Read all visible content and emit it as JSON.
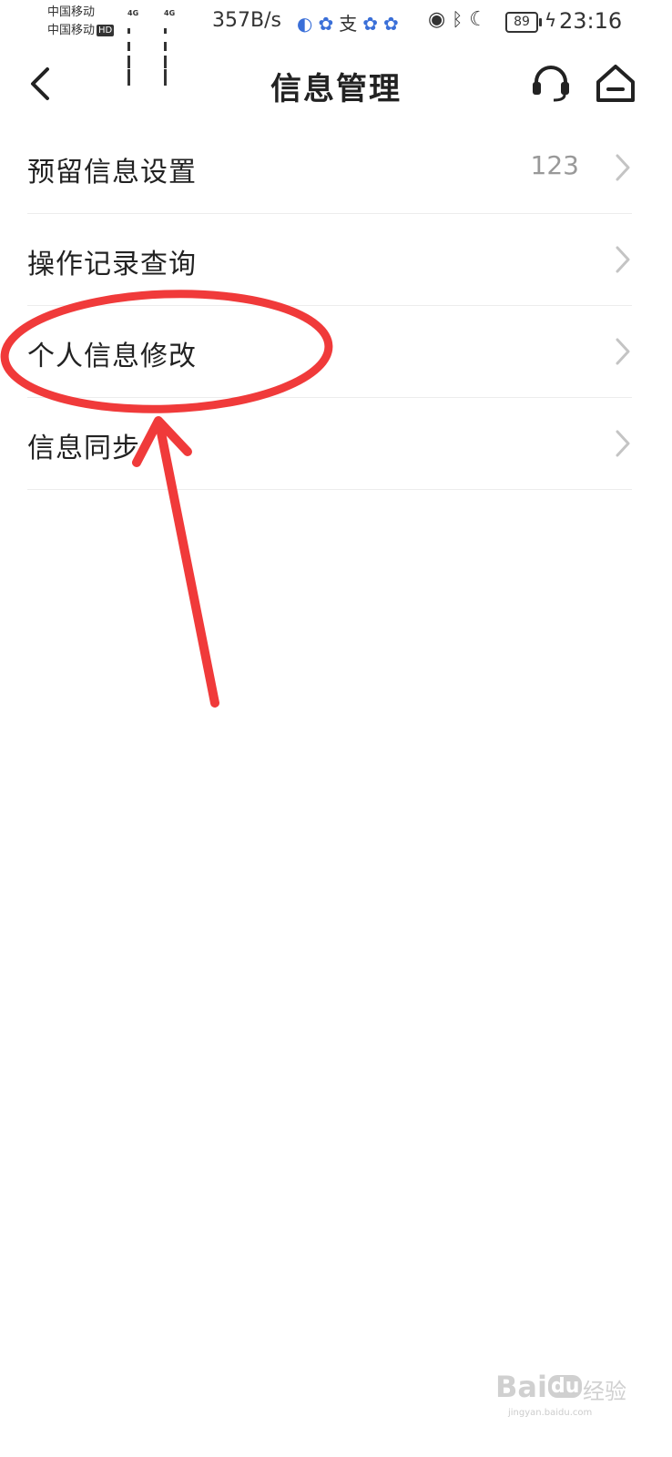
{
  "status_bar": {
    "carrier_1": "中国移动",
    "carrier_2": "中国移动",
    "hd_badge": "HD",
    "network_1": "4G",
    "network_2": "4G",
    "speed": "357B/s",
    "app_icons": [
      "browser-icon",
      "paw-icon",
      "alipay-icon",
      "paw-icon",
      "paw-icon"
    ],
    "alipay_glyph": "支",
    "battery_level": "89",
    "time": "23:16",
    "icons": [
      "eye-icon",
      "bluetooth-icon",
      "moon-icon",
      "battery-icon",
      "charging-icon"
    ]
  },
  "header": {
    "title": "信息管理",
    "back_icon": "chevron-left-icon",
    "service_icon": "headset-icon",
    "home_icon": "home-icon"
  },
  "menu": {
    "items": [
      {
        "label": "预留信息设置",
        "value": "123"
      },
      {
        "label": "操作记录查询",
        "value": ""
      },
      {
        "label": "个人信息修改",
        "value": ""
      },
      {
        "label": "信息同步",
        "value": ""
      }
    ]
  },
  "annotation": {
    "color": "#f03a3a",
    "highlighted_item": "个人信息修改"
  },
  "watermark": {
    "brand": "Bai",
    "brand_2": "du",
    "text": "经验",
    "url": "jingyan.baidu.com"
  }
}
